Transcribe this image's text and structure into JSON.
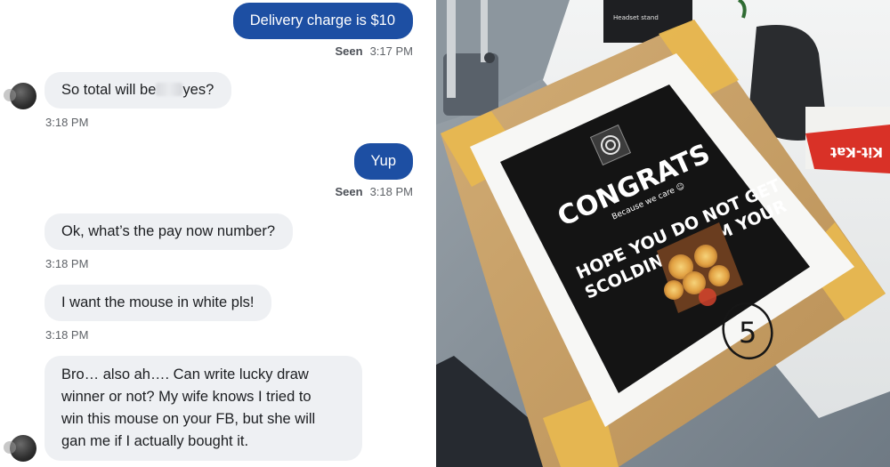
{
  "messages": [
    {
      "direction": "outgoing",
      "text": "Delivery charge is $10"
    },
    {
      "direction": "incoming",
      "text_before": "So total will be",
      "text_after": "yes?",
      "time": "3:18 PM"
    },
    {
      "direction": "outgoing",
      "text": "Yup"
    },
    {
      "direction": "incoming",
      "text": "Ok, what’s the pay now number?",
      "time": "3:18 PM"
    },
    {
      "direction": "incoming",
      "text": "I want the mouse in white pls!",
      "time": "3:18 PM"
    },
    {
      "direction": "incoming",
      "lines": [
        "Bro… also ah…. Can write lucky draw",
        "winner or not? My wife knows I tried to",
        "win this mouse on your FB, but she will",
        "gan me if I actually bought it."
      ]
    }
  ],
  "status": {
    "seen_label": "Seen",
    "seen_time_1": "3:17 PM",
    "seen_time_2": "3:18 PM"
  },
  "photo": {
    "poster_title": "CONGRATS",
    "poster_tagline": "Because we care ☺",
    "poster_line_1": "HOPE YOU DO NOT GET",
    "poster_line_2": "SCOLDING FROM YOUR",
    "box_number": "5",
    "headset_label": "Headset stand",
    "wrapper_text": "Kit-Kat"
  },
  "colors": {
    "outgoing_bubble": "#1d4fa3",
    "incoming_bubble": "#eef0f3",
    "cardboard": "#c9a36b",
    "tape": "#e7b750",
    "poster_black": "#141414"
  }
}
